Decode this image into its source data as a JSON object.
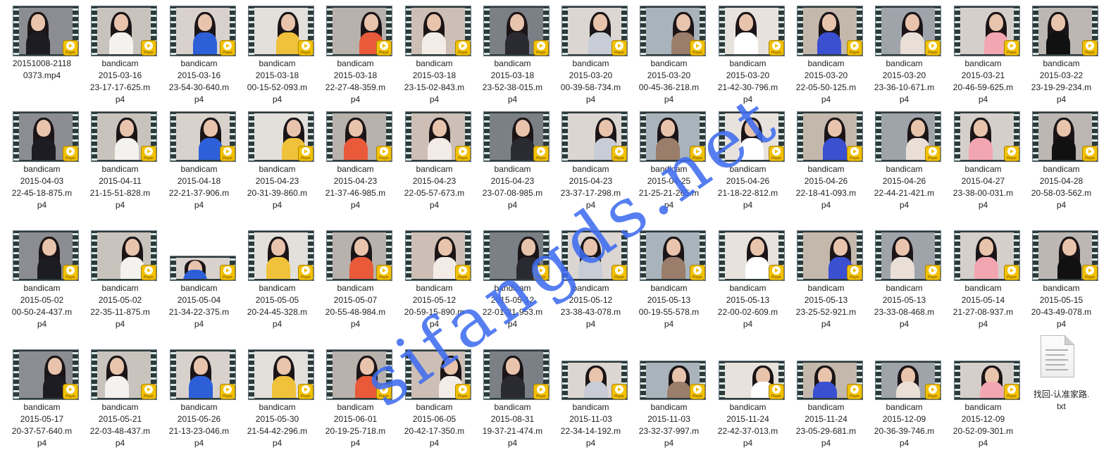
{
  "watermark": "sifangds.net",
  "player_badge_text": "Player",
  "files": [
    {
      "name": "20151008-2118\n0373.mp4",
      "type": "video"
    },
    {
      "name": "bandicam\n2015-03-16\n23-17-17-625.m\np4",
      "type": "video"
    },
    {
      "name": "bandicam\n2015-03-16\n23-54-30-640.m\np4",
      "type": "video"
    },
    {
      "name": "bandicam\n2015-03-18\n00-15-52-093.m\np4",
      "type": "video"
    },
    {
      "name": "bandicam\n2015-03-18\n22-27-48-359.m\np4",
      "type": "video"
    },
    {
      "name": "bandicam\n2015-03-18\n23-15-02-843.m\np4",
      "type": "video"
    },
    {
      "name": "bandicam\n2015-03-18\n23-52-38-015.m\np4",
      "type": "video"
    },
    {
      "name": "bandicam\n2015-03-20\n00-39-58-734.m\np4",
      "type": "video"
    },
    {
      "name": "bandicam\n2015-03-20\n00-45-36-218.m\np4",
      "type": "video"
    },
    {
      "name": "bandicam\n2015-03-20\n21-42-30-796.m\np4",
      "type": "video"
    },
    {
      "name": "bandicam\n2015-03-20\n22-05-50-125.m\np4",
      "type": "video"
    },
    {
      "name": "bandicam\n2015-03-20\n23-36-10-671.m\np4",
      "type": "video"
    },
    {
      "name": "bandicam\n2015-03-21\n20-46-59-625.m\np4",
      "type": "video"
    },
    {
      "name": "bandicam\n2015-03-22\n23-19-29-234.m\np4",
      "type": "video"
    },
    {
      "name": "bandicam\n2015-04-03\n22-45-18-875.m\np4",
      "type": "video"
    },
    {
      "name": "bandicam\n2015-04-11\n21-15-51-828.m\np4",
      "type": "video"
    },
    {
      "name": "bandicam\n2015-04-18\n22-21-37-906.m\np4",
      "type": "video"
    },
    {
      "name": "bandicam\n2015-04-23\n20-31-39-860.m\np4",
      "type": "video"
    },
    {
      "name": "bandicam\n2015-04-23\n21-37-46-985.m\np4",
      "type": "video"
    },
    {
      "name": "bandicam\n2015-04-23\n22-05-57-673.m\np4",
      "type": "video"
    },
    {
      "name": "bandicam\n2015-04-23\n23-07-08-985.m\np4",
      "type": "video"
    },
    {
      "name": "bandicam\n2015-04-23\n23-37-17-298.m\np4",
      "type": "video"
    },
    {
      "name": "bandicam\n2015-04-25\n21-25-21-265.m\np4",
      "type": "video"
    },
    {
      "name": "bandicam\n2015-04-26\n21-18-22-812.m\np4",
      "type": "video"
    },
    {
      "name": "bandicam\n2015-04-26\n22-18-41-093.m\np4",
      "type": "video"
    },
    {
      "name": "bandicam\n2015-04-26\n22-44-21-421.m\np4",
      "type": "video"
    },
    {
      "name": "bandicam\n2015-04-27\n23-38-00-031.m\np4",
      "type": "video"
    },
    {
      "name": "bandicam\n2015-04-28\n20-58-03-562.m\np4",
      "type": "video"
    },
    {
      "name": "bandicam\n2015-05-02\n00-50-24-437.m\np4",
      "type": "video"
    },
    {
      "name": "bandicam\n2015-05-02\n22-35-11-875.m\np4",
      "type": "video"
    },
    {
      "name": "bandicam\n2015-05-04\n21-34-22-375.m\np4",
      "type": "video"
    },
    {
      "name": "bandicam\n2015-05-05\n20-24-45-328.m\np4",
      "type": "video"
    },
    {
      "name": "bandicam\n2015-05-07\n20-55-48-984.m\np4",
      "type": "video"
    },
    {
      "name": "bandicam\n2015-05-12\n20-59-15-890.m\np4",
      "type": "video"
    },
    {
      "name": "bandicam\n2015-05-12\n22-01-21-953.m\np4",
      "type": "video"
    },
    {
      "name": "bandicam\n2015-05-12\n23-38-43-078.m\np4",
      "type": "video"
    },
    {
      "name": "bandicam\n2015-05-13\n00-19-55-578.m\np4",
      "type": "video"
    },
    {
      "name": "bandicam\n2015-05-13\n22-00-02-609.m\np4",
      "type": "video"
    },
    {
      "name": "bandicam\n2015-05-13\n23-25-52-921.m\np4",
      "type": "video"
    },
    {
      "name": "bandicam\n2015-05-13\n23-33-08-468.m\np4",
      "type": "video"
    },
    {
      "name": "bandicam\n2015-05-14\n21-27-08-937.m\np4",
      "type": "video"
    },
    {
      "name": "bandicam\n2015-05-15\n20-43-49-078.m\np4",
      "type": "video"
    },
    {
      "name": "bandicam\n2015-05-17\n20-37-57-640.m\np4",
      "type": "video"
    },
    {
      "name": "bandicam\n2015-05-21\n22-03-48-437.m\np4",
      "type": "video"
    },
    {
      "name": "bandicam\n2015-05-26\n21-13-23-046.m\np4",
      "type": "video"
    },
    {
      "name": "bandicam\n2015-05-30\n21-54-42-296.m\np4",
      "type": "video"
    },
    {
      "name": "bandicam\n2015-06-01\n20-19-25-718.m\np4",
      "type": "video"
    },
    {
      "name": "bandicam\n2015-06-05\n20-42-17-350.m\np4",
      "type": "video"
    },
    {
      "name": "bandicam\n2015-08-31\n19-37-21-474.m\np4",
      "type": "video"
    },
    {
      "name": "bandicam\n2015-11-03\n22-34-14-192.m\np4",
      "type": "video"
    },
    {
      "name": "bandicam\n2015-11-03\n23-32-37-997.m\np4",
      "type": "video"
    },
    {
      "name": "bandicam\n2015-11-24\n22-42-37-013.m\np4",
      "type": "video"
    },
    {
      "name": "bandicam\n2015-11-24\n23-05-29-681.m\np4",
      "type": "video"
    },
    {
      "name": "bandicam\n2015-12-09\n20-36-39-746.m\np4",
      "type": "video"
    },
    {
      "name": "bandicam\n2015-12-09\n20-52-09-301.m\np4",
      "type": "video"
    },
    {
      "name": "找回-认准家路.\ntxt",
      "type": "text"
    }
  ]
}
